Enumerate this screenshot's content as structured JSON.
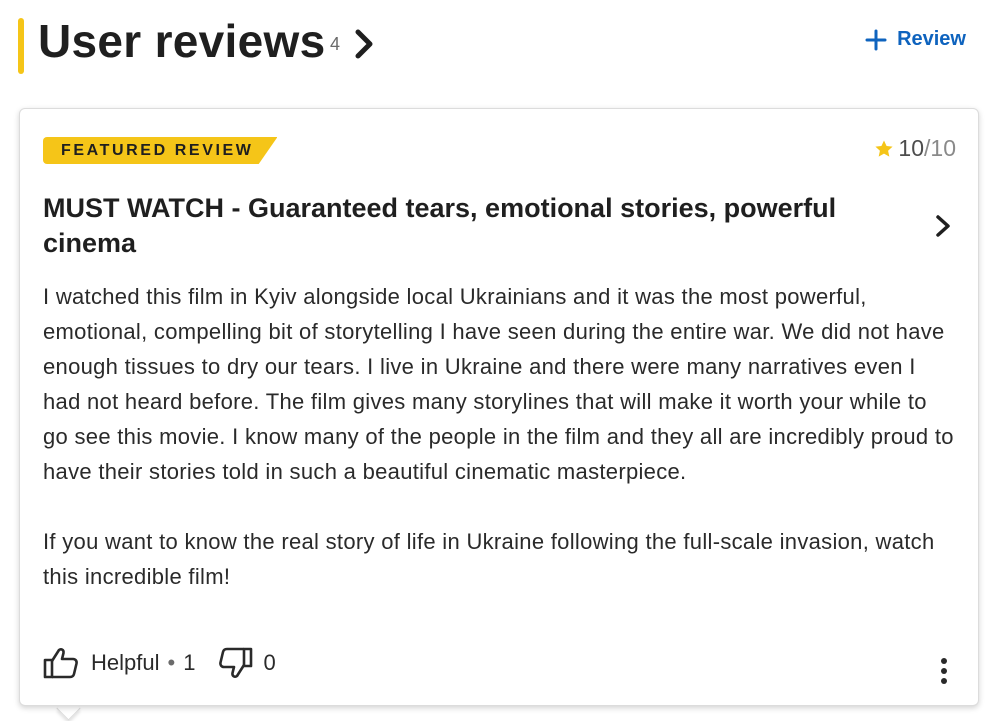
{
  "header": {
    "title": "User reviews",
    "count": "4",
    "add_review_label": "Review"
  },
  "review": {
    "badge": "FEATURED REVIEW",
    "rating_score": "10",
    "rating_max": "/10",
    "title": "MUST WATCH - Guaranteed tears, emotional stories, powerful cinema",
    "body_paragraphs": [
      "I watched this film in Kyiv alongside local Ukrainians and it was the most powerful, emotional, compelling bit of storytelling I have seen during the entire war. We did not have enough tissues to dry our tears. I live in Ukraine and there were many narratives even I had not heard before. The film gives many storylines that will make it worth your while to go see this movie. I know many of the people in the film and they all are incredibly proud to have their stories told in such a beautiful cinematic masterpiece.",
      "If you want to know the real story of life in Ukraine following the full-scale invasion, watch this incredible film!"
    ],
    "helpful_label": "Helpful",
    "separator": "•",
    "helpful_count": "1",
    "not_helpful_count": "0"
  },
  "icons": {
    "chevron": "chevron-right-icon",
    "plus": "plus-icon",
    "star": "star-icon",
    "thumbs_up": "thumbs-up-icon",
    "thumbs_down": "thumbs-down-icon",
    "more": "more-vertical-icon"
  },
  "colors": {
    "accent": "#f5c518",
    "link": "#0e63be",
    "text": "#1f1f1f",
    "muted": "#6b6b6b"
  }
}
